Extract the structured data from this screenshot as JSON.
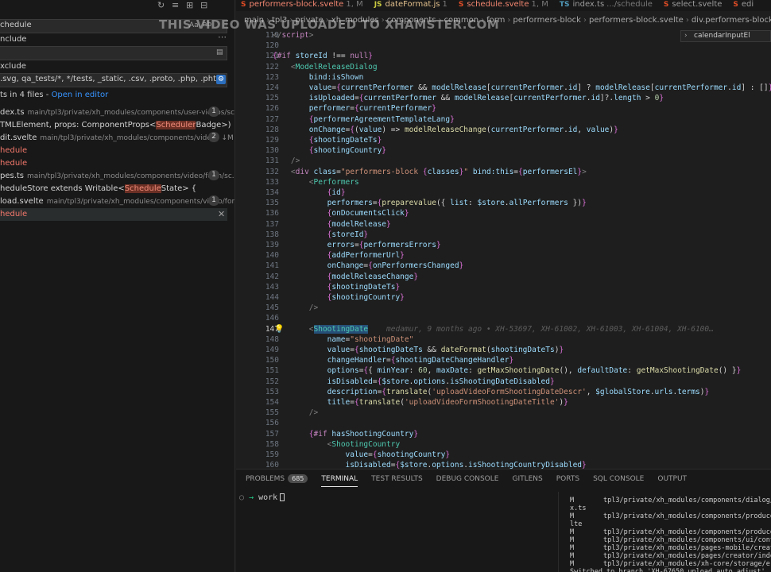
{
  "watermark": "THIS VIDEO WAS UPLOADED TO XHAMSTER.COM",
  "sidebar": {
    "search_value": "chedule",
    "search_case_label": "Aa",
    "include_label": "nclude",
    "exclude_label": "xclude",
    "exclude_value": ".svg, qa_tests/*, */tests, _static, .csv, .proto, .php, .phtml",
    "summary_text": "ts in 4 files - ",
    "open_in_editor": "Open in editor",
    "results": [
      {
        "kind": "file",
        "name": "dex.ts",
        "path": "main/tpl3/private/xh_modules/components/user-videos/sc...",
        "count": "1"
      },
      {
        "kind": "match",
        "pre": "TMLElement, props: ComponentProps<",
        "hl": "Scheduler",
        "post": "Badge>) {"
      },
      {
        "kind": "file",
        "name": "dit.svelte",
        "path": "main/tpl3/private/xh_modules/components/vide...",
        "extra": "↓M",
        "count": "2"
      },
      {
        "kind": "match-red",
        "text": "hedule"
      },
      {
        "kind": "match-red",
        "text": "hedule"
      },
      {
        "kind": "file",
        "name": "pes.ts",
        "path": "main/tpl3/private/xh_modules/components/video/form/sc...",
        "count": "1"
      },
      {
        "kind": "match",
        "pre": "heduleStore extends Writable<",
        "hl": "Schedule",
        "post": "State> {"
      },
      {
        "kind": "file",
        "name": "load.svelte",
        "path": "main/tpl3/private/xh_modules/components/video/for...",
        "count": "1"
      },
      {
        "kind": "match-red",
        "text": "hedule"
      }
    ]
  },
  "tabs": [
    {
      "icon": "S",
      "name": "performers-block.svelte",
      "desc": "1, M",
      "state": "err"
    },
    {
      "icon": "JS",
      "name": "dateFormat.js",
      "desc": "1",
      "state": "mod"
    },
    {
      "icon": "S",
      "name": "schedule.svelte",
      "desc": "1, M",
      "state": "err"
    },
    {
      "icon": "TS",
      "name": "index.ts",
      "desc": ".../schedule",
      "state": "plain"
    },
    {
      "icon": "S",
      "name": "select.svelte",
      "desc": "",
      "state": "plain"
    },
    {
      "icon": "S",
      "name": "edi",
      "desc": "",
      "state": "plain"
    }
  ],
  "breadcrumb": [
    "main",
    "tpl3",
    "private",
    "xh_modules",
    "components",
    "common",
    "form",
    "performers-block",
    "performers-block.svelte",
    "div.performers-block {cl"
  ],
  "sticky_hint": "calendarInputEl",
  "editor": {
    "line_numbers": [
      "119",
      "120",
      "121",
      "122",
      "123",
      "124",
      "125",
      "126",
      "127",
      "128",
      "129",
      "130",
      "131",
      "132",
      "133",
      "134",
      "135",
      "136",
      "137",
      "138",
      "139",
      "140",
      "141",
      "142",
      "143",
      "144",
      "145",
      "146",
      "147",
      "148",
      "149",
      "150",
      "151",
      "152",
      "153",
      "154",
      "155",
      "156",
      "157",
      "158",
      "159",
      "160"
    ],
    "blame": "medamur, 9 months ago • XH-53697, XH-61002, XH-61003, XH-61004, XH-6100…"
  },
  "panel": {
    "tabs": [
      {
        "label": "PROBLEMS",
        "badge": "685"
      },
      {
        "label": "TERMINAL",
        "badge": ""
      },
      {
        "label": "TEST RESULTS",
        "badge": ""
      },
      {
        "label": "DEBUG CONSOLE",
        "badge": ""
      },
      {
        "label": "GITLENS",
        "badge": ""
      },
      {
        "label": "PORTS",
        "badge": ""
      },
      {
        "label": "SQL CONSOLE",
        "badge": ""
      },
      {
        "label": "OUTPUT",
        "badge": ""
      }
    ],
    "active_tab": "TERMINAL",
    "prompt_dir": "work",
    "git_lines": [
      {
        "status": "M",
        "path": "tpl3/private/xh_modules/components/dialog/"
      },
      {
        "status": "",
        "path": "x.ts"
      },
      {
        "status": "M",
        "path": "tpl3/private/xh_modules/components/produce"
      },
      {
        "status": "",
        "path": "lte"
      },
      {
        "status": "M",
        "path": "tpl3/private/xh_modules/components/produce"
      },
      {
        "status": "M",
        "path": "tpl3/private/xh_modules/components/ui/cont"
      },
      {
        "status": "M",
        "path": "tpl3/private/xh_modules/pages-mobile/creat"
      },
      {
        "status": "M",
        "path": "tpl3/private/xh_modules/pages/creator/inde"
      },
      {
        "status": "M",
        "path": "tpl3/private/xh_modules/xh-core/storage/er"
      },
      {
        "status": "",
        "path": "Switched to branch 'XH-67650_upload_auto_adjust'"
      }
    ]
  },
  "colors": {
    "accent": "#3794ff",
    "match_bg": "#6b2f24",
    "tag": "#4ec9b0",
    "attr": "#9cdcfe",
    "string": "#ce9178"
  }
}
